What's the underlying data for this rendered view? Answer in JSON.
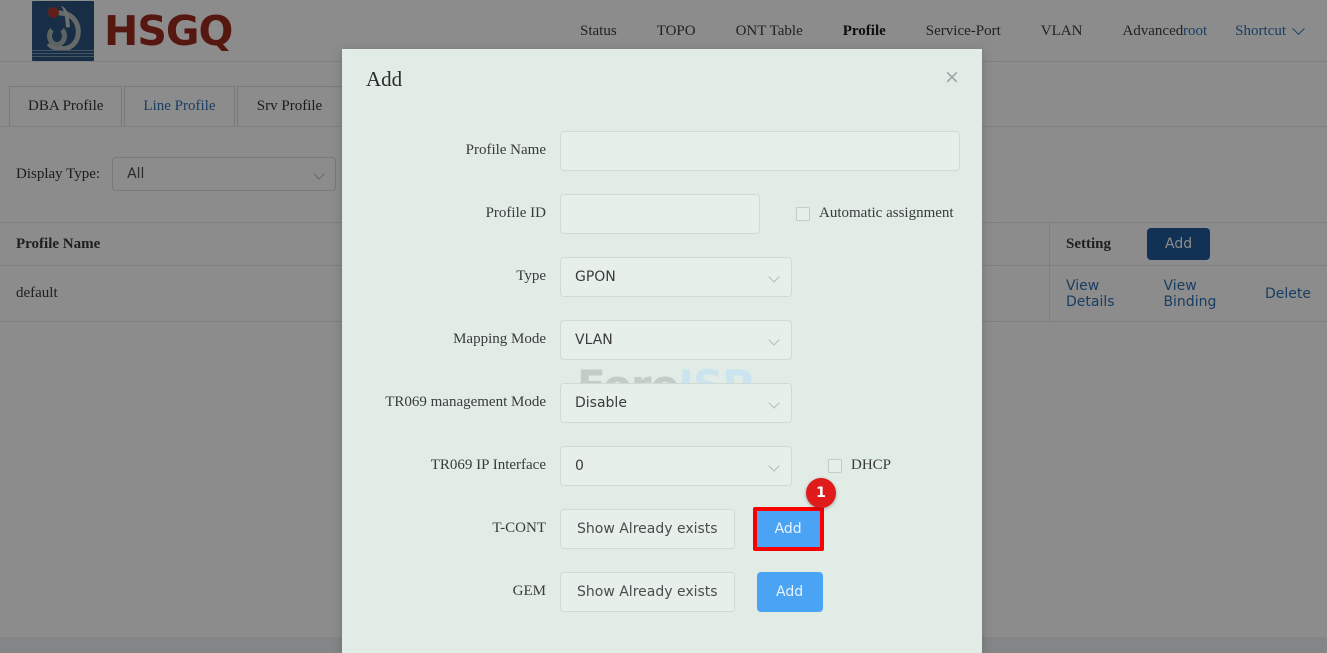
{
  "brand": {
    "name": "HSGQ",
    "logo_icon": "hsgq-logo-icon"
  },
  "nav": {
    "items": [
      {
        "label": "Status",
        "active": false
      },
      {
        "label": "TOPO",
        "active": false
      },
      {
        "label": "ONT Table",
        "active": false
      },
      {
        "label": "Profile",
        "active": true
      },
      {
        "label": "Service-Port",
        "active": false
      },
      {
        "label": "VLAN",
        "active": false
      },
      {
        "label": "Advanced",
        "active": false
      }
    ],
    "user": "root",
    "shortcut": "Shortcut",
    "shortcut_icon": "chevron-down-icon"
  },
  "tabs": [
    {
      "label": "DBA Profile",
      "active": false
    },
    {
      "label": "Line Profile",
      "active": true
    },
    {
      "label": "Srv Profile",
      "active": false
    }
  ],
  "filter": {
    "display_type_label": "Display Type:",
    "display_type_value": "All",
    "dropdown_icon": "chevron-down-icon"
  },
  "table": {
    "headers": [
      "Profile Name",
      "",
      "",
      "Setting"
    ],
    "header_add_label": "Add",
    "rows": [
      {
        "profile_name": "default",
        "col2": "",
        "col3": "",
        "actions": [
          "View Details",
          "View Binding",
          "Delete"
        ]
      }
    ]
  },
  "modal": {
    "title": "Add",
    "close_icon": "close-icon",
    "fields": {
      "profile_name": {
        "label": "Profile Name",
        "value": "",
        "placeholder": ""
      },
      "profile_id": {
        "label": "Profile ID",
        "value": "",
        "placeholder": ""
      },
      "automatic_assignment": {
        "label": "Automatic assignment",
        "checked": false
      },
      "type": {
        "label": "Type",
        "value": "GPON"
      },
      "mapping_mode": {
        "label": "Mapping Mode",
        "value": "VLAN"
      },
      "tr069_management_mode": {
        "label": "TR069 management Mode",
        "value": "Disable"
      },
      "tr069_ip_interface": {
        "label": "TR069 IP Interface",
        "value": "0"
      },
      "dhcp": {
        "label": "DHCP",
        "checked": false
      },
      "tcont": {
        "label": "T-CONT",
        "show_label": "Show Already exists",
        "add_label": "Add"
      },
      "gem": {
        "label": "GEM",
        "show_label": "Show Already exists",
        "add_label": "Add"
      }
    }
  },
  "annotation": {
    "badge": "1"
  },
  "watermark": {
    "part_a": "Foro",
    "part_b": "ISP"
  },
  "colors": {
    "brand_red": "#9d2b20",
    "logo_blue": "#2b5480",
    "link_blue": "#2f6fb5",
    "button_blue": "#4aa3f3",
    "table_button_blue": "#1f5c99",
    "modal_bg": "#e2ece6",
    "highlight_red": "#fa0000",
    "badge_red": "#e01b1b"
  }
}
